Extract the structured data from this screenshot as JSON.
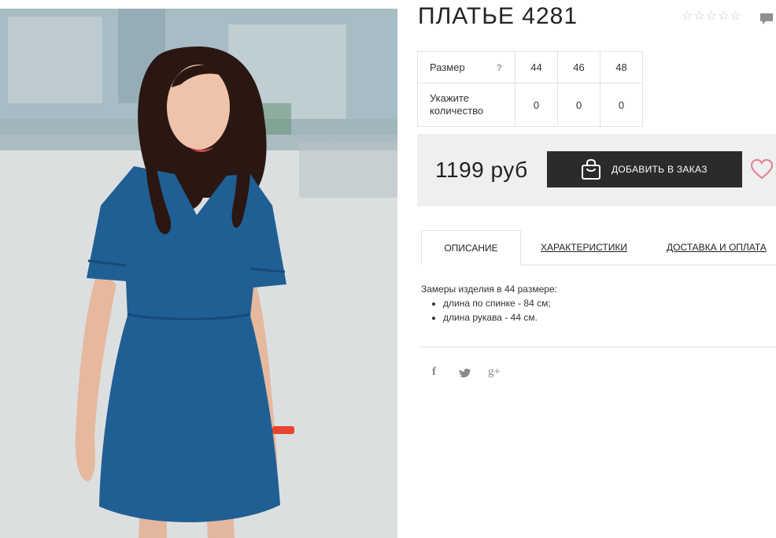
{
  "product": {
    "title": "ПЛАТЬЕ 4281",
    "rating_stars": [
      "☆",
      "☆",
      "☆",
      "☆",
      "☆"
    ]
  },
  "icons": {
    "comment": "comment-icon",
    "bag": "shopping-bag-icon",
    "heart": "heart-icon"
  },
  "size_table": {
    "size_label": "Размер",
    "help": "?",
    "sizes": [
      "44",
      "46",
      "48"
    ],
    "qty_label_line1": "Укажите",
    "qty_label_line2": "количество",
    "quantities": [
      "0",
      "0",
      "0"
    ]
  },
  "buy": {
    "price": "1199 руб",
    "add_button": "ДОБАВИТЬ В ЗАКАЗ"
  },
  "tabs": [
    {
      "label": "ОПИСАНИЕ",
      "active": true
    },
    {
      "label": "ХАРАКТЕРИСТИКИ",
      "active": false
    },
    {
      "label": "ДОСТАВКА И ОПЛАТА",
      "active": false
    }
  ],
  "description": {
    "intro": "Замеры изделия в 44 размере:",
    "items": [
      "длина по спинке - 84 см;",
      "длина рукава - 44 см."
    ]
  },
  "social": {
    "facebook": "f",
    "twitter": "🐦",
    "googleplus": "g+"
  },
  "colors": {
    "dress": "#1f5f94",
    "button": "#2b2b2b",
    "heart": "#e07f8f",
    "panel": "#efefef"
  }
}
